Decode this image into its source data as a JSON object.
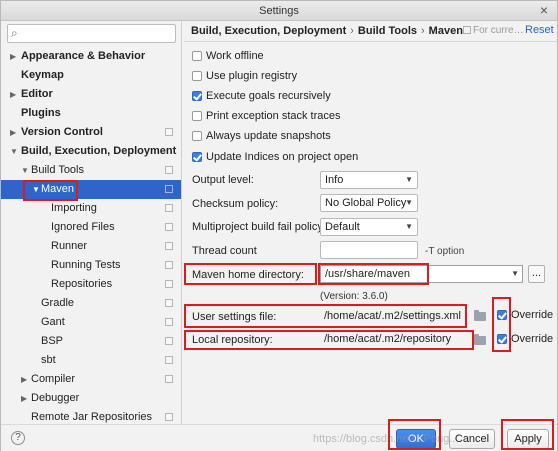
{
  "window": {
    "title": "Settings"
  },
  "sidebar": {
    "items": [
      {
        "label": "Appearance & Behavior",
        "expanded": false,
        "bold": true
      },
      {
        "label": "Keymap",
        "bold": true
      },
      {
        "label": "Editor",
        "expanded": false,
        "bold": true
      },
      {
        "label": "Plugins",
        "bold": true
      },
      {
        "label": "Version Control",
        "expanded": false,
        "bold": true
      },
      {
        "label": "Build, Execution, Deployment",
        "expanded": true,
        "bold": true
      },
      {
        "label": "Build Tools",
        "expanded": true
      },
      {
        "label": "Maven",
        "expanded": true,
        "selected": true
      },
      {
        "label": "Importing"
      },
      {
        "label": "Ignored Files"
      },
      {
        "label": "Runner"
      },
      {
        "label": "Running Tests"
      },
      {
        "label": "Repositories"
      },
      {
        "label": "Gradle"
      },
      {
        "label": "Gant"
      },
      {
        "label": "BSP"
      },
      {
        "label": "sbt"
      },
      {
        "label": "Compiler",
        "expanded": false
      },
      {
        "label": "Debugger",
        "expanded": false
      },
      {
        "label": "Remote Jar Repositories"
      }
    ]
  },
  "header": {
    "breadcrumb": [
      "Build, Execution, Deployment",
      "Build Tools",
      "Maven"
    ],
    "for_current": "For curre…",
    "reset": "Reset"
  },
  "options": {
    "work_offline": "Work offline",
    "use_plugin_registry": "Use plugin registry",
    "execute_goals_recursively": "Execute goals recursively",
    "print_exception_stack_traces": "Print exception stack traces",
    "always_update_snapshots": "Always update snapshots",
    "update_indices": "Update Indices on project open"
  },
  "fields": {
    "output_level_label": "Output level:",
    "output_level_value": "Info",
    "checksum_policy_label": "Checksum policy:",
    "checksum_policy_value": "No Global Policy",
    "multiproject_label": "Multiproject build fail policy:",
    "multiproject_value": "Default",
    "thread_count_label": "Thread count",
    "thread_count_hint": "-T option",
    "maven_home_label": "Maven home directory:",
    "maven_home_value": "/usr/share/maven",
    "maven_version": "(Version: 3.6.0)",
    "user_settings_label": "User settings file:",
    "user_settings_value": "/home/acat/.m2/settings.xml",
    "local_repo_label": "Local repository:",
    "local_repo_value": "/home/acat/.m2/repository",
    "override_label": "Override"
  },
  "footer": {
    "help": "?",
    "ok": "OK",
    "cancel": "Cancel",
    "apply": "Apply",
    "watermark": "https://blog.csdn.net/...Pong..."
  },
  "colors": {
    "selection": "#2f65ca",
    "highlight": "#d91d1d",
    "link": "#2a62c8"
  }
}
